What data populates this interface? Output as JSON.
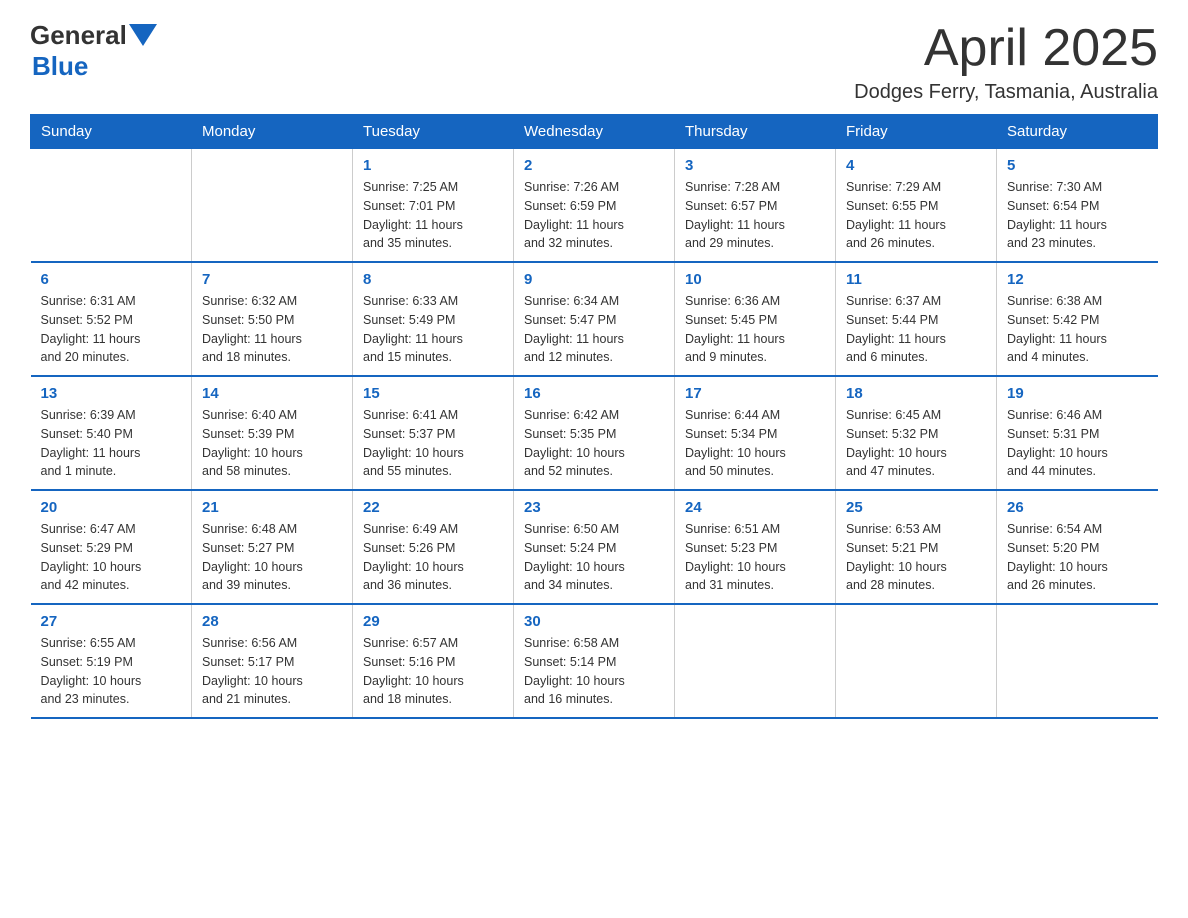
{
  "header": {
    "logo_general": "General",
    "logo_blue": "Blue",
    "month_year": "April 2025",
    "location": "Dodges Ferry, Tasmania, Australia"
  },
  "calendar": {
    "days_of_week": [
      "Sunday",
      "Monday",
      "Tuesday",
      "Wednesday",
      "Thursday",
      "Friday",
      "Saturday"
    ],
    "weeks": [
      [
        {
          "day": "",
          "info": ""
        },
        {
          "day": "",
          "info": ""
        },
        {
          "day": "1",
          "info": "Sunrise: 7:25 AM\nSunset: 7:01 PM\nDaylight: 11 hours\nand 35 minutes."
        },
        {
          "day": "2",
          "info": "Sunrise: 7:26 AM\nSunset: 6:59 PM\nDaylight: 11 hours\nand 32 minutes."
        },
        {
          "day": "3",
          "info": "Sunrise: 7:28 AM\nSunset: 6:57 PM\nDaylight: 11 hours\nand 29 minutes."
        },
        {
          "day": "4",
          "info": "Sunrise: 7:29 AM\nSunset: 6:55 PM\nDaylight: 11 hours\nand 26 minutes."
        },
        {
          "day": "5",
          "info": "Sunrise: 7:30 AM\nSunset: 6:54 PM\nDaylight: 11 hours\nand 23 minutes."
        }
      ],
      [
        {
          "day": "6",
          "info": "Sunrise: 6:31 AM\nSunset: 5:52 PM\nDaylight: 11 hours\nand 20 minutes."
        },
        {
          "day": "7",
          "info": "Sunrise: 6:32 AM\nSunset: 5:50 PM\nDaylight: 11 hours\nand 18 minutes."
        },
        {
          "day": "8",
          "info": "Sunrise: 6:33 AM\nSunset: 5:49 PM\nDaylight: 11 hours\nand 15 minutes."
        },
        {
          "day": "9",
          "info": "Sunrise: 6:34 AM\nSunset: 5:47 PM\nDaylight: 11 hours\nand 12 minutes."
        },
        {
          "day": "10",
          "info": "Sunrise: 6:36 AM\nSunset: 5:45 PM\nDaylight: 11 hours\nand 9 minutes."
        },
        {
          "day": "11",
          "info": "Sunrise: 6:37 AM\nSunset: 5:44 PM\nDaylight: 11 hours\nand 6 minutes."
        },
        {
          "day": "12",
          "info": "Sunrise: 6:38 AM\nSunset: 5:42 PM\nDaylight: 11 hours\nand 4 minutes."
        }
      ],
      [
        {
          "day": "13",
          "info": "Sunrise: 6:39 AM\nSunset: 5:40 PM\nDaylight: 11 hours\nand 1 minute."
        },
        {
          "day": "14",
          "info": "Sunrise: 6:40 AM\nSunset: 5:39 PM\nDaylight: 10 hours\nand 58 minutes."
        },
        {
          "day": "15",
          "info": "Sunrise: 6:41 AM\nSunset: 5:37 PM\nDaylight: 10 hours\nand 55 minutes."
        },
        {
          "day": "16",
          "info": "Sunrise: 6:42 AM\nSunset: 5:35 PM\nDaylight: 10 hours\nand 52 minutes."
        },
        {
          "day": "17",
          "info": "Sunrise: 6:44 AM\nSunset: 5:34 PM\nDaylight: 10 hours\nand 50 minutes."
        },
        {
          "day": "18",
          "info": "Sunrise: 6:45 AM\nSunset: 5:32 PM\nDaylight: 10 hours\nand 47 minutes."
        },
        {
          "day": "19",
          "info": "Sunrise: 6:46 AM\nSunset: 5:31 PM\nDaylight: 10 hours\nand 44 minutes."
        }
      ],
      [
        {
          "day": "20",
          "info": "Sunrise: 6:47 AM\nSunset: 5:29 PM\nDaylight: 10 hours\nand 42 minutes."
        },
        {
          "day": "21",
          "info": "Sunrise: 6:48 AM\nSunset: 5:27 PM\nDaylight: 10 hours\nand 39 minutes."
        },
        {
          "day": "22",
          "info": "Sunrise: 6:49 AM\nSunset: 5:26 PM\nDaylight: 10 hours\nand 36 minutes."
        },
        {
          "day": "23",
          "info": "Sunrise: 6:50 AM\nSunset: 5:24 PM\nDaylight: 10 hours\nand 34 minutes."
        },
        {
          "day": "24",
          "info": "Sunrise: 6:51 AM\nSunset: 5:23 PM\nDaylight: 10 hours\nand 31 minutes."
        },
        {
          "day": "25",
          "info": "Sunrise: 6:53 AM\nSunset: 5:21 PM\nDaylight: 10 hours\nand 28 minutes."
        },
        {
          "day": "26",
          "info": "Sunrise: 6:54 AM\nSunset: 5:20 PM\nDaylight: 10 hours\nand 26 minutes."
        }
      ],
      [
        {
          "day": "27",
          "info": "Sunrise: 6:55 AM\nSunset: 5:19 PM\nDaylight: 10 hours\nand 23 minutes."
        },
        {
          "day": "28",
          "info": "Sunrise: 6:56 AM\nSunset: 5:17 PM\nDaylight: 10 hours\nand 21 minutes."
        },
        {
          "day": "29",
          "info": "Sunrise: 6:57 AM\nSunset: 5:16 PM\nDaylight: 10 hours\nand 18 minutes."
        },
        {
          "day": "30",
          "info": "Sunrise: 6:58 AM\nSunset: 5:14 PM\nDaylight: 10 hours\nand 16 minutes."
        },
        {
          "day": "",
          "info": ""
        },
        {
          "day": "",
          "info": ""
        },
        {
          "day": "",
          "info": ""
        }
      ]
    ]
  }
}
